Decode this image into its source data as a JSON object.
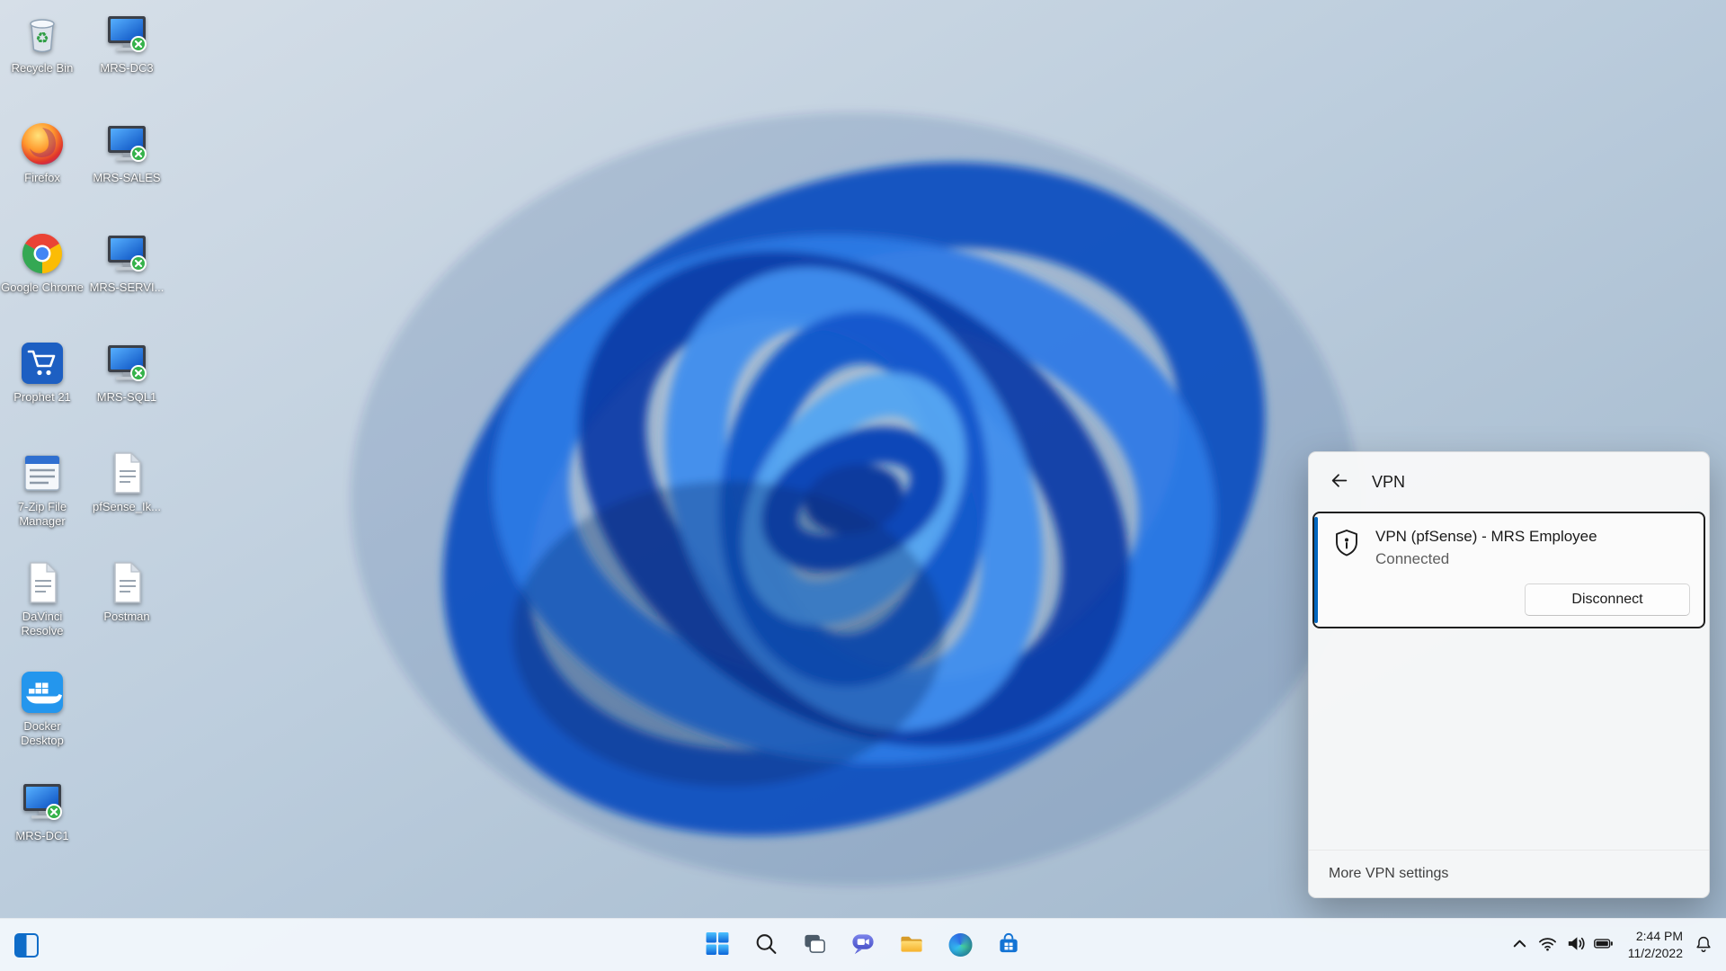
{
  "colors": {
    "accent": "#0067c0",
    "selection_border": "#1f1f1f",
    "panel_bg": "#f6f7f8",
    "taskbar_bg": "#f1f6fb",
    "desktop_label": "#ffffff",
    "bloom_blues": [
      "#0f4fc0",
      "#2e7ae6",
      "#0b3ca8",
      "#3f8eee",
      "#55a5f2"
    ]
  },
  "desktop": {
    "icons_col1": [
      {
        "label": "Recycle Bin",
        "icon": "recycle-bin-icon"
      },
      {
        "label": "Firefox",
        "icon": "firefox-icon"
      },
      {
        "label": "Google Chrome",
        "icon": "chrome-icon"
      },
      {
        "label": "Prophet 21",
        "icon": "shopping-cart-icon"
      },
      {
        "label": "7-Zip File Manager",
        "icon": "file-manager-icon"
      },
      {
        "label": "DaVinci Resolve",
        "icon": "document-icon"
      },
      {
        "label": "Docker Desktop",
        "icon": "docker-whale-icon"
      },
      {
        "label": "MRS-DC1",
        "icon": "remote-desktop-icon"
      }
    ],
    "icons_col2": [
      {
        "label": "MRS-DC3",
        "icon": "remote-desktop-icon"
      },
      {
        "label": "MRS-SALES",
        "icon": "remote-desktop-icon"
      },
      {
        "label": "MRS-SERVI...",
        "icon": "remote-desktop-icon"
      },
      {
        "label": "MRS-SQL1",
        "icon": "remote-desktop-icon"
      },
      {
        "label": "pfSense_Ik...",
        "icon": "document-icon"
      },
      {
        "label": "Postman",
        "icon": "document-icon"
      }
    ]
  },
  "vpn_panel": {
    "title": "VPN",
    "back_icon": "arrow-left-icon",
    "connection": {
      "icon": "vpn-shield-icon",
      "name": "VPN (pfSense) - MRS Employee",
      "status": "Connected",
      "disconnect_label": "Disconnect"
    },
    "footer_link": "More VPN settings"
  },
  "taskbar": {
    "left_icons": [
      "pinned-corner-app-icon"
    ],
    "center_icons": [
      "start-icon",
      "search-icon",
      "task-view-icon",
      "chat-icon",
      "file-explorer-icon",
      "edge-icon",
      "store-icon"
    ],
    "tray_icons": [
      "chevron-up-icon",
      "wifi-icon",
      "volume-icon",
      "battery-icon"
    ],
    "clock": {
      "time": "2:44 PM",
      "date": "11/2/2022"
    },
    "notification_icon": "bell-icon"
  }
}
